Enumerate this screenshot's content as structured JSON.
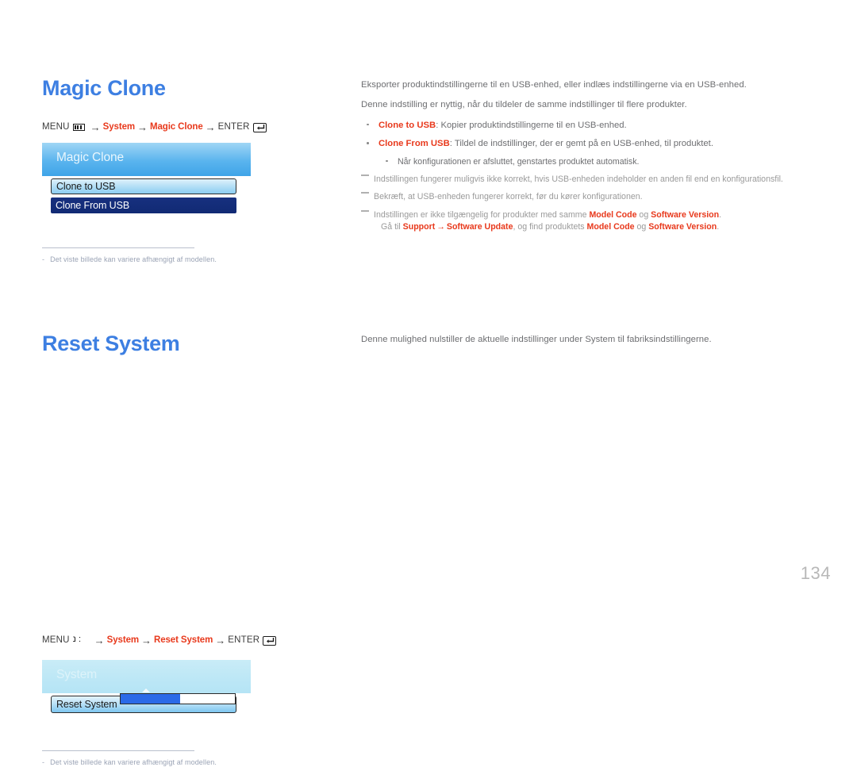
{
  "page": {
    "number": "134",
    "language": "da"
  },
  "sections": [
    {
      "id": "magic-clone",
      "title": "Magic Clone",
      "breadcrumb": {
        "menu_label": "MENU",
        "menu_icon": "menu-bars-icon",
        "arrow": "→",
        "step1": "System",
        "step2": "Magic Clone",
        "enter_label": "ENTER",
        "enter_icon": "enter-key-icon"
      },
      "osd": {
        "header": "Magic Clone",
        "rows": [
          {
            "label": "Clone to USB",
            "state": "selected"
          },
          {
            "label": "Clone From USB",
            "state": "dark"
          }
        ]
      },
      "footnote": {
        "dash": "-",
        "text": "Det viste billede kan variere afhængigt af modellen."
      },
      "body": {
        "paragraphs": [
          "Eksporter produktindstillingerne til en USB-enhed, eller indlæs indstillingerne via en USB-enhed.",
          "Denne indstilling er nyttig, når du tildeler de samme indstillinger til flere produkter."
        ],
        "bullets": [
          {
            "keyword": "Clone to USB",
            "text": ": Kopier produktindstillingerne til en USB-enhed."
          },
          {
            "keyword": "Clone From USB",
            "text": ": Tildel de indstillinger, der er gemt på en USB-enhed, til produktet."
          }
        ],
        "subbullets": [
          "Når konfigurationen er afsluttet, genstartes produktet automatisk."
        ],
        "notes": [
          {
            "text": "Indstillingen fungerer muligvis ikke korrekt, hvis USB-enheden indeholder en anden fil end en konfigurationsfil."
          },
          {
            "text": "Bekræft, at USB-enheden fungerer korrekt, før du kører konfigurationen."
          }
        ],
        "note_rich": {
          "line1_a": "Indstillingen er ikke tilgængelig for produkter med samme ",
          "line1_kw1": "Model Code",
          "line1_b": " og ",
          "line1_kw2": "Software Version",
          "line1_c": ".",
          "line2_a": "Gå til ",
          "line2_kw1": "Support",
          "line2_arrow": "→",
          "line2_kw2": "Software Update",
          "line2_b": ", og find produktets ",
          "line2_kw3": "Model Code",
          "line2_c": " og ",
          "line2_kw4": "Software Version",
          "line2_d": "."
        }
      }
    },
    {
      "id": "reset-system",
      "title": "Reset System",
      "breadcrumb": {
        "menu_label": "MENU",
        "menu_icon": "menu-bars-icon-degraded",
        "menu_glyph": "נ :",
        "arrow": "→",
        "step1": "System",
        "step2": "Reset System",
        "enter_label": "ENTER",
        "enter_icon": "enter-key-icon"
      },
      "osd": {
        "header": "System",
        "row": {
          "label": "Reset System",
          "state": "progress"
        },
        "progress": {
          "percent": 52
        }
      },
      "footnote": {
        "dash": "-",
        "text": "Det viste billede kan variere afhængigt af modellen."
      },
      "body": {
        "paragraphs": [
          "Denne mulighed nulstiller de aktuelle indstillinger under System til fabriksindstillingerne."
        ]
      }
    }
  ],
  "colors": {
    "heading_blue": "#3d7fe2",
    "keyword_red": "#e8391c",
    "body_gray": "#6d6e71",
    "note_gray": "#9a9a9a",
    "footnote_gray": "#9aa3b5",
    "osd_header_blue": "#5ab4ee",
    "osd_header_faded": "#bce7f6",
    "osd_dark_navy": "#17307f",
    "progress_blue": "#2b6ae8",
    "page_number_gray": "#b8b8b8"
  }
}
